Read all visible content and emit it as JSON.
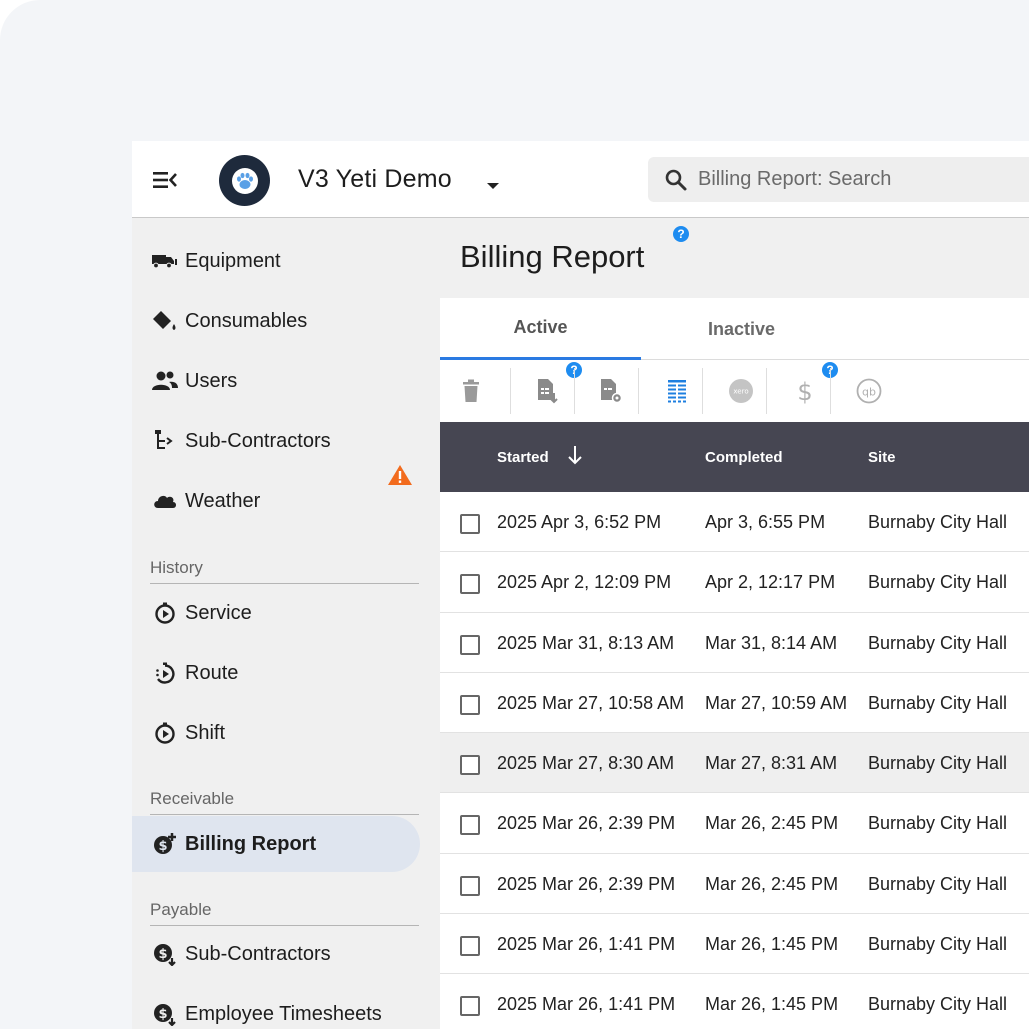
{
  "header": {
    "org_name": "V3 Yeti Demo",
    "search_placeholder": "Billing Report: Search"
  },
  "sidebar": {
    "items": [
      {
        "label": "Equipment",
        "icon": "truck-icon"
      },
      {
        "label": "Consumables",
        "icon": "paint-bucket-icon"
      },
      {
        "label": "Users",
        "icon": "users-icon"
      },
      {
        "label": "Sub-Contractors",
        "icon": "hierarchy-icon"
      },
      {
        "label": "Weather",
        "icon": "cloud-icon"
      }
    ],
    "history_label": "History",
    "history_items": [
      {
        "label": "Service",
        "icon": "timer-icon"
      },
      {
        "label": "Route",
        "icon": "route-timer-icon"
      },
      {
        "label": "Shift",
        "icon": "timer-icon"
      }
    ],
    "receivable_label": "Receivable",
    "receivable_items": [
      {
        "label": "Billing Report",
        "icon": "billing-icon"
      }
    ],
    "payable_label": "Payable",
    "payable_items": [
      {
        "label": "Sub-Contractors",
        "icon": "payable-icon"
      },
      {
        "label": "Employee Timesheets",
        "icon": "payable-icon"
      }
    ]
  },
  "page": {
    "title": "Billing Report",
    "help": "?"
  },
  "tabs": [
    {
      "label": "Active",
      "active": true
    },
    {
      "label": "Inactive",
      "active": false
    }
  ],
  "toolbar": {
    "icons": [
      "trash-icon",
      "export-file-icon",
      "file-settings-icon",
      "columns-icon",
      "xero-icon",
      "dollar-icon",
      "quickbooks-icon"
    ],
    "help": "?"
  },
  "table": {
    "columns": [
      "Started",
      "Completed",
      "Site"
    ],
    "rows": [
      {
        "started": "2025 Apr 3, 6:52 PM",
        "completed": "Apr 3, 6:55 PM",
        "site": "Burnaby City Hall"
      },
      {
        "started": "2025 Apr 2, 12:09 PM",
        "completed": "Apr 2, 12:17 PM",
        "site": "Burnaby City Hall"
      },
      {
        "started": "2025 Mar 31, 8:13 AM",
        "completed": "Mar 31, 8:14 AM",
        "site": "Burnaby City Hall"
      },
      {
        "started": "2025 Mar 27, 10:58 AM",
        "completed": "Mar 27, 10:59 AM",
        "site": "Burnaby City Hall"
      },
      {
        "started": "2025 Mar 27, 8:30 AM",
        "completed": "Mar 27, 8:31 AM",
        "site": "Burnaby City Hall"
      },
      {
        "started": "2025 Mar 26, 2:39 PM",
        "completed": "Mar 26, 2:45 PM",
        "site": "Burnaby City Hall"
      },
      {
        "started": "2025 Mar 26, 2:39 PM",
        "completed": "Mar 26, 2:45 PM",
        "site": "Burnaby City Hall"
      },
      {
        "started": "2025 Mar 26, 1:41 PM",
        "completed": "Mar 26, 1:45 PM",
        "site": "Burnaby City Hall"
      },
      {
        "started": "2025 Mar 26, 1:41 PM",
        "completed": "Mar 26, 1:45 PM",
        "site": "Burnaby City Hall"
      }
    ]
  },
  "colors": {
    "accent": "#2a7ae2",
    "header_bg": "#464652",
    "active_nav_bg": "#dfe5ef",
    "warning": "#f26b1d",
    "help": "#1e8cf0"
  }
}
